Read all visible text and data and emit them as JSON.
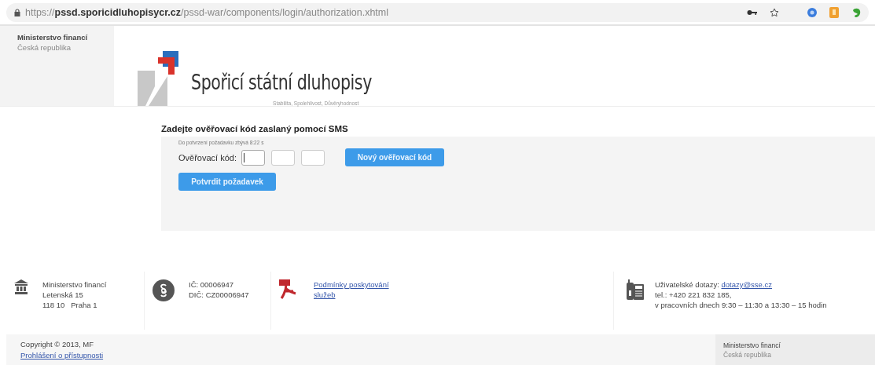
{
  "browser": {
    "url_scheme": "https://",
    "url_host": "pssd.sporicidluhopisycr.cz",
    "url_path": "/pssd-war/components/login/authorization.xhtml"
  },
  "header": {
    "ministry": "Ministerstvo financí",
    "country": "Česká republika",
    "logo_title": "Spořicí státní dluhopisy",
    "tagline": "Stabilita, Spolehlivost, Důvěryhodnost"
  },
  "form": {
    "heading": "Zadejte ověřovací kód zaslaný pomocí SMS",
    "countdown": "Do potvrzení požadavku zbývá 8:22 s",
    "code_label": "Ověřovací kód:",
    "code_fields": [
      {
        "focused": true
      },
      {
        "focused": false
      },
      {
        "focused": false
      }
    ],
    "new_code_button": "Nový ověřovací kód",
    "confirm_button": "Potvrdit požadavek"
  },
  "footer": {
    "address": [
      "Ministerstvo financí",
      "Letenská 15",
      "118 10   Praha 1"
    ],
    "ids": [
      "IČ: 00006947",
      "DIČ: CZ00006947"
    ],
    "terms_link": "Podmínky poskytování služeb",
    "contact_label": "Uživatelské dotazy:",
    "contact_email": "dotazy@sse.cz",
    "phone": "tel.: +420 221 832 185,",
    "hours": "v pracovních dnech 9:30 – 11:30 a 13:30 – 15 hodin",
    "copyright": "Copyright © 2013, MF",
    "accessibility_link": "Prohlášení o přístupnosti",
    "ministry": "Ministerstvo financí",
    "country": "Česká republika"
  }
}
